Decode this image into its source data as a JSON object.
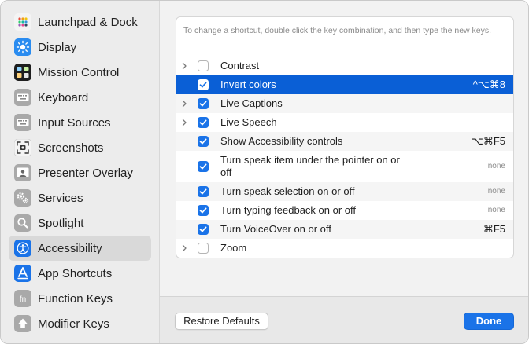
{
  "sidebar": {
    "items": [
      {
        "label": "Launchpad & Dock",
        "icon": "launchpad-dock-icon"
      },
      {
        "label": "Display",
        "icon": "display-icon"
      },
      {
        "label": "Mission Control",
        "icon": "mission-control-icon"
      },
      {
        "label": "Keyboard",
        "icon": "keyboard-icon"
      },
      {
        "label": "Input Sources",
        "icon": "input-sources-icon"
      },
      {
        "label": "Screenshots",
        "icon": "screenshots-icon"
      },
      {
        "label": "Presenter Overlay",
        "icon": "presenter-overlay-icon"
      },
      {
        "label": "Services",
        "icon": "services-gear-icon"
      },
      {
        "label": "Spotlight",
        "icon": "spotlight-icon"
      },
      {
        "label": "Accessibility",
        "icon": "accessibility-icon",
        "selected": true
      },
      {
        "label": "App Shortcuts",
        "icon": "app-shortcuts-icon"
      },
      {
        "label": "Function Keys",
        "icon": "function-keys-icon",
        "icon_text": "fn"
      },
      {
        "label": "Modifier Keys",
        "icon": "modifier-keys-icon"
      }
    ]
  },
  "main": {
    "hint": "To change a shortcut, double click the key combination, and then type the new keys.",
    "rows": [
      {
        "label": "Contrast",
        "checked": false,
        "expandable": true,
        "shortcut": ""
      },
      {
        "label": "Invert colors",
        "checked": true,
        "expandable": false,
        "shortcut": "^⌥⌘8",
        "selected": true
      },
      {
        "label": "Live Captions",
        "checked": true,
        "expandable": true,
        "shortcut": ""
      },
      {
        "label": "Live Speech",
        "checked": true,
        "expandable": true,
        "shortcut": ""
      },
      {
        "label": "Show Accessibility controls",
        "checked": true,
        "expandable": false,
        "shortcut": "⌥⌘F5"
      },
      {
        "label": "Turn speak item under the pointer on or off",
        "checked": true,
        "expandable": false,
        "shortcut": "none"
      },
      {
        "label": "Turn speak selection on or off",
        "checked": true,
        "expandable": false,
        "shortcut": "none"
      },
      {
        "label": "Turn typing feedback on or off",
        "checked": true,
        "expandable": false,
        "shortcut": "none"
      },
      {
        "label": "Turn VoiceOver on or off",
        "checked": true,
        "expandable": false,
        "shortcut": "⌘F5"
      },
      {
        "label": "Zoom",
        "checked": false,
        "expandable": true,
        "shortcut": ""
      }
    ]
  },
  "footer": {
    "restore_label": "Restore Defaults",
    "done_label": "Done"
  },
  "colors": {
    "accent": "#1a73e8",
    "selected_row": "#0a5fd6",
    "sidebar_bg": "#ececec"
  }
}
